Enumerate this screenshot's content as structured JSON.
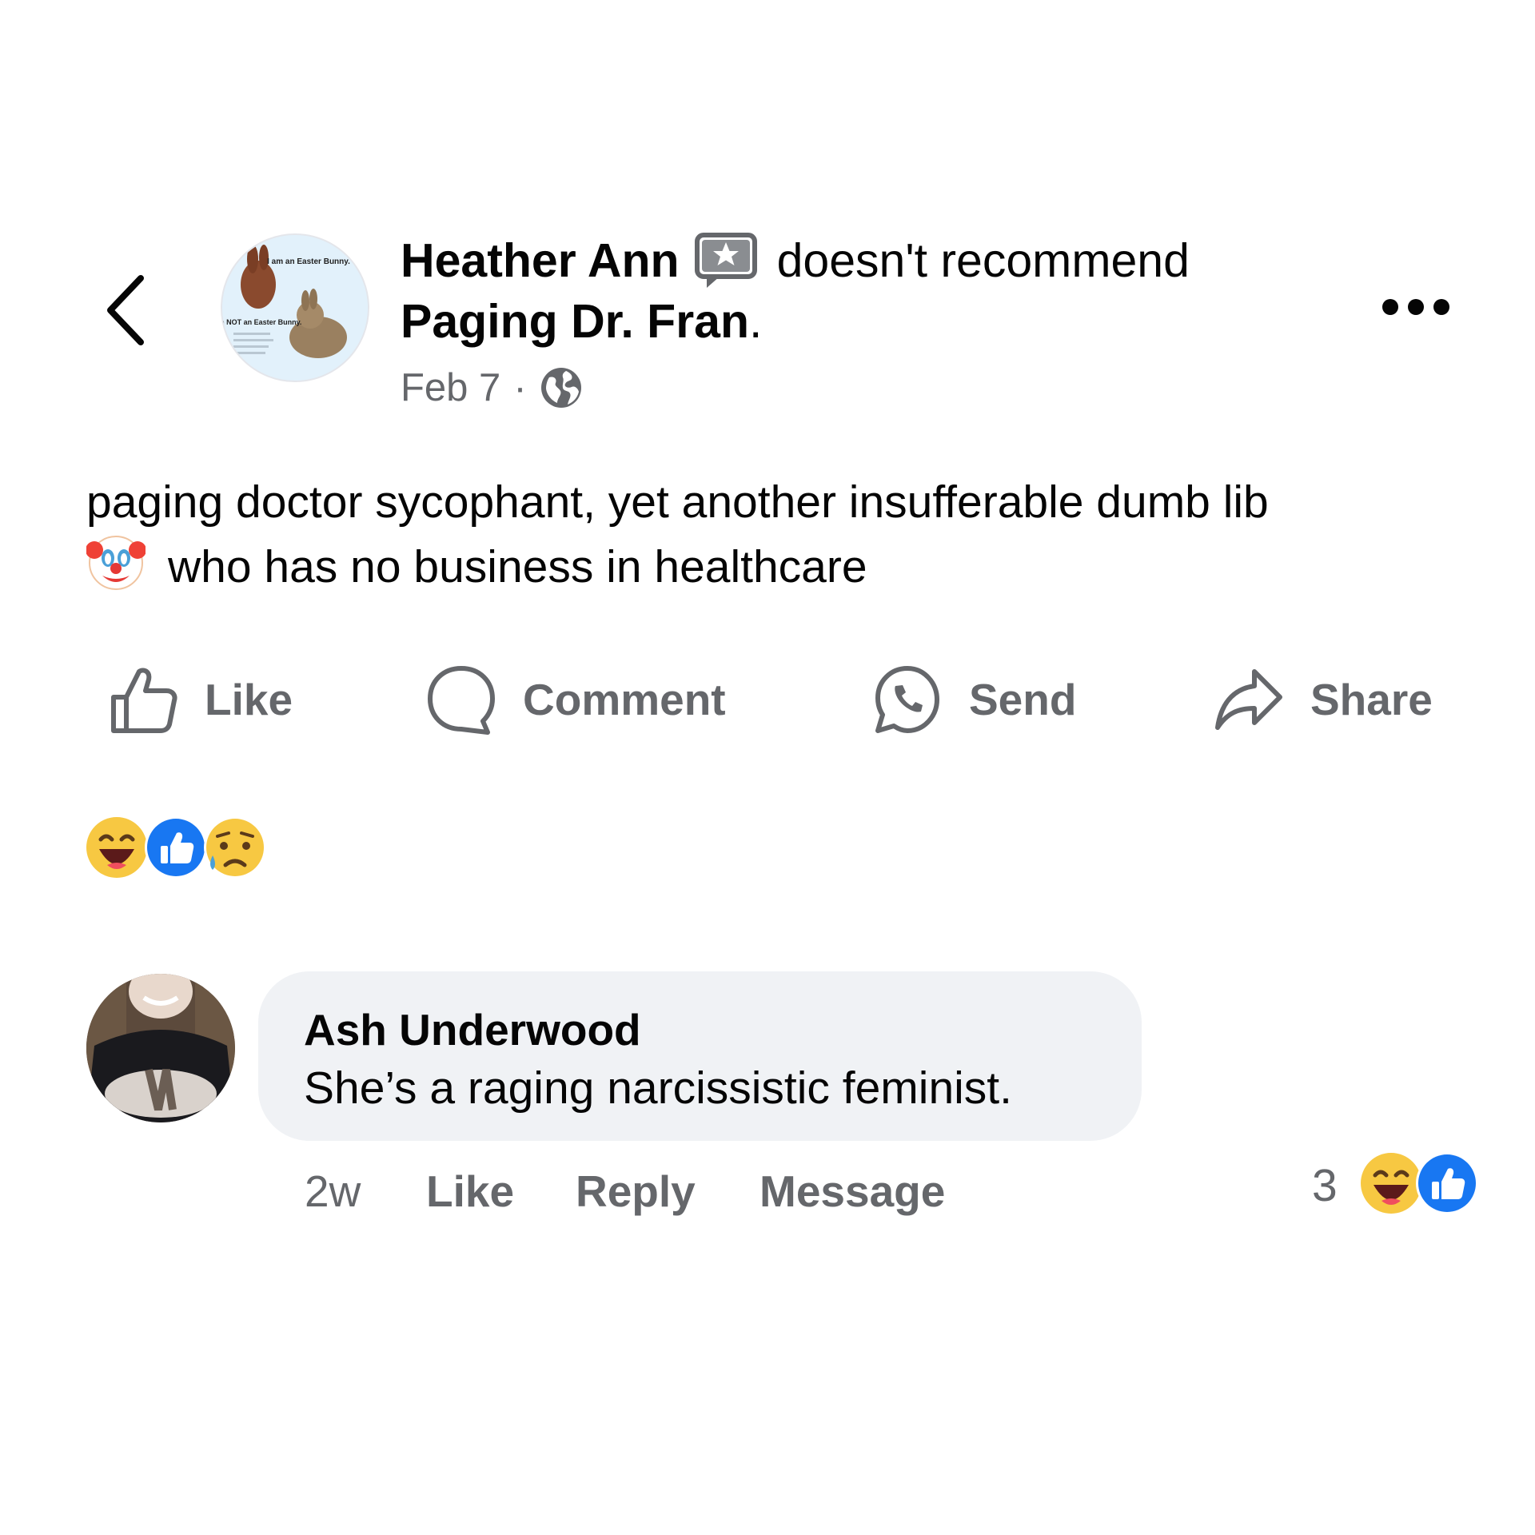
{
  "post": {
    "author": "Heather Ann",
    "recommendation_text": "doesn't recommend",
    "page_name": "Paging Dr. Fran",
    "page_name_end": ".",
    "date": "Feb 7",
    "separator": "·",
    "body_line1": "paging doctor sycophant,  yet another insufferable dumb lib",
    "body_line2": "who has no business in healthcare",
    "reactions": [
      "haha-reaction-icon",
      "like-reaction-icon",
      "sad-reaction-icon"
    ]
  },
  "actions": {
    "like": "Like",
    "comment": "Comment",
    "send": "Send",
    "share": "Share"
  },
  "avatar_image_text": {
    "line_top": "I am an Easter Bunny.",
    "line_bottom": "I am NOT an Easter Bunny."
  },
  "comment": {
    "author": "Ash Underwood",
    "text": "She’s a raging narcissistic feminist.",
    "time": "2w",
    "like": "Like",
    "reply": "Reply",
    "message": "Message",
    "reaction_count": "3",
    "reactions": [
      "haha-reaction-icon",
      "like-reaction-icon"
    ]
  },
  "colors": {
    "text": "#050505",
    "secondary_text": "#65676b",
    "bubble_bg": "#f0f2f5",
    "like_blue": "#1877f2",
    "emoji_yellow": "#f7c842"
  }
}
